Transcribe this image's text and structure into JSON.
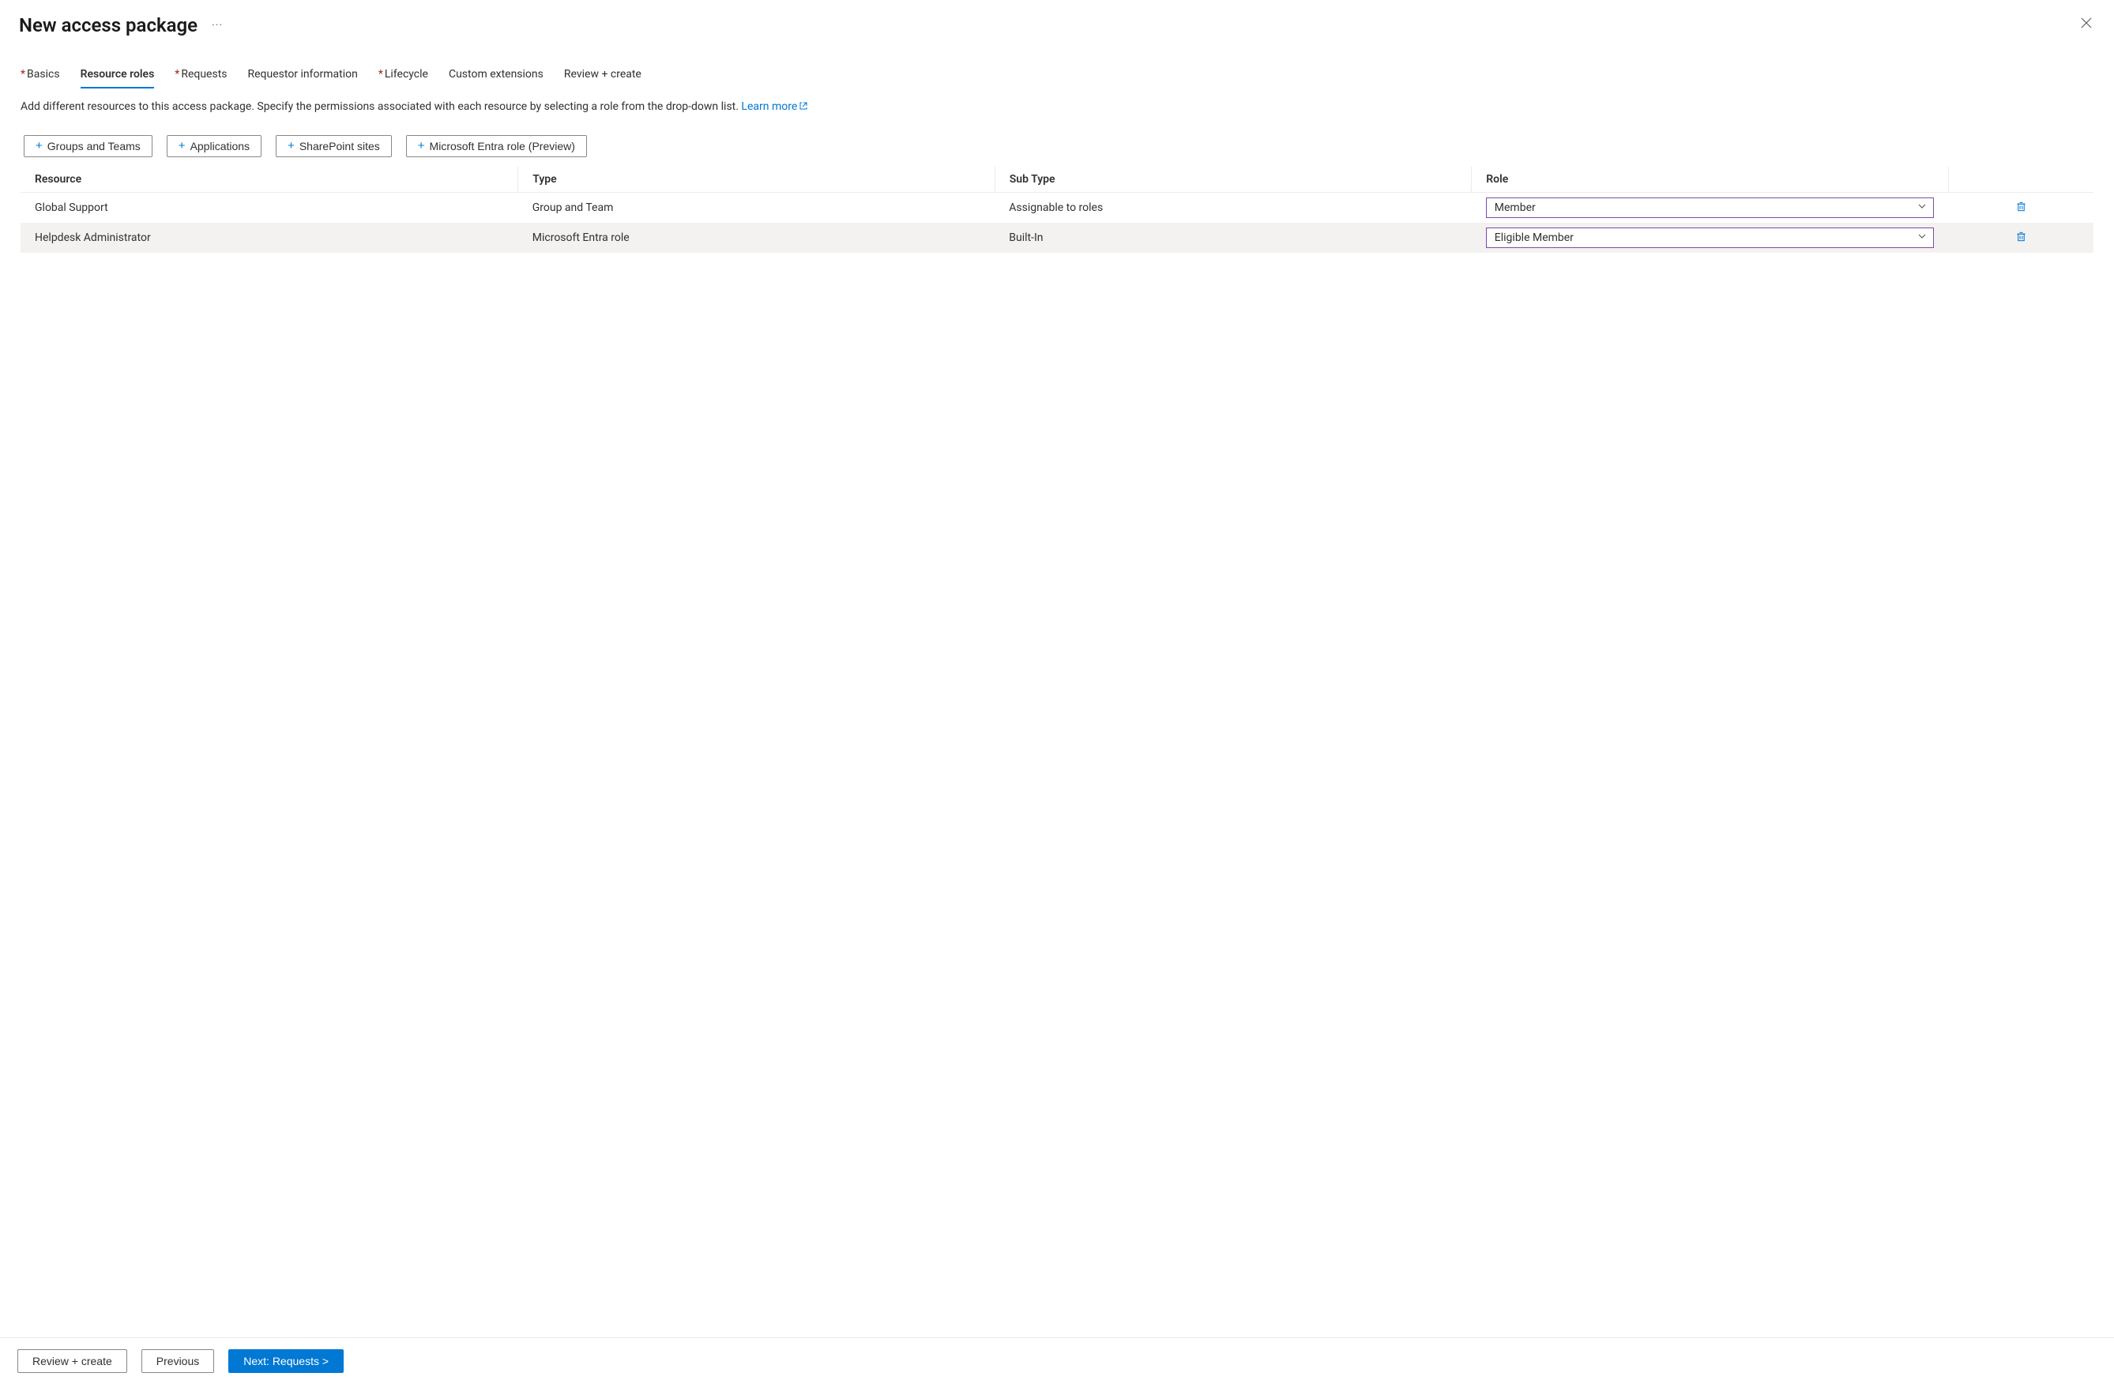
{
  "header": {
    "title": "New access package",
    "more_icon_glyph": "···"
  },
  "tabs": [
    {
      "label": "Basics",
      "required": true,
      "active": false
    },
    {
      "label": "Resource roles",
      "required": false,
      "active": true
    },
    {
      "label": "Requests",
      "required": true,
      "active": false
    },
    {
      "label": "Requestor information",
      "required": false,
      "active": false
    },
    {
      "label": "Lifecycle",
      "required": true,
      "active": false
    },
    {
      "label": "Custom extensions",
      "required": false,
      "active": false
    },
    {
      "label": "Review + create",
      "required": false,
      "active": false
    }
  ],
  "description": {
    "text": "Add different resources to this access package. Specify the permissions associated with each resource by selecting a role from the drop-down list. ",
    "link_text": "Learn more"
  },
  "add_buttons": [
    {
      "label": "Groups and Teams"
    },
    {
      "label": "Applications"
    },
    {
      "label": "SharePoint sites"
    },
    {
      "label": "Microsoft Entra role (Preview)"
    }
  ],
  "table": {
    "columns": {
      "resource": "Resource",
      "type": "Type",
      "subtype": "Sub Type",
      "role": "Role"
    },
    "rows": [
      {
        "resource": "Global Support",
        "type": "Group and Team",
        "subtype": "Assignable to roles",
        "role": "Member"
      },
      {
        "resource": "Helpdesk Administrator",
        "type": "Microsoft Entra role",
        "subtype": "Built-In",
        "role": "Eligible Member"
      }
    ]
  },
  "footer": {
    "review_label": "Review + create",
    "previous_label": "Previous",
    "next_label": "Next: Requests >"
  }
}
